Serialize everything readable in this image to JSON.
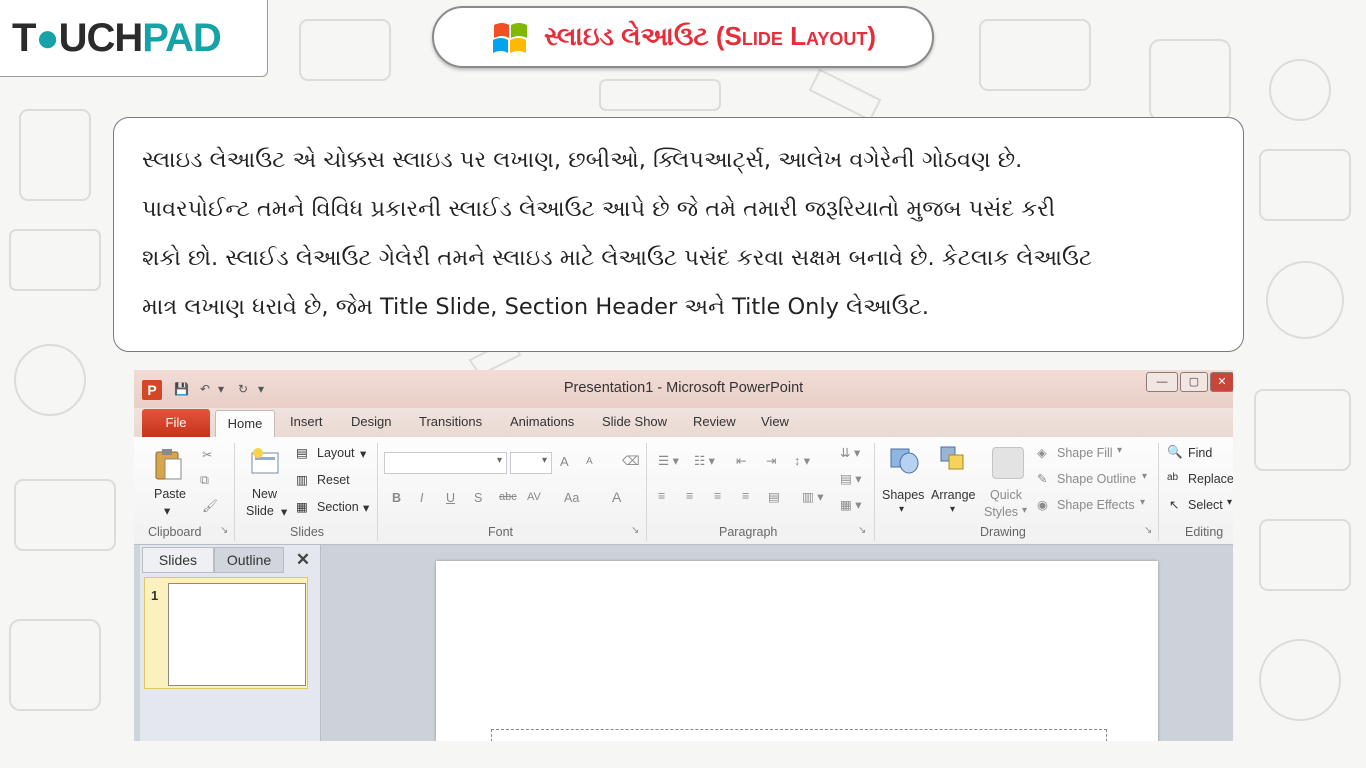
{
  "logo": {
    "part1": "T",
    "part2": "UCH",
    "part3": "PAD",
    "text": "TOUCHPAD"
  },
  "title": {
    "text": "સ્લાઇડ લેઆઉટ (Slide Layout)"
  },
  "paragraph_lines": [
    "સ્લાઇડ લેઆઉટ એ ચોક્કસ સ્લાઇડ પર લખાણ, છબીઓ, ક્લિપઆર્ટ્સ, આલેખ વગેરેની ગોઠવણ છે.",
    "પાવરપોઈન્ટ તમને વિવિધ પ્રકારની સ્લાઈડ લેઆઉટ આપે છે જે તમે તમારી જરૂરિયાતો મુજબ પસંદ કરી",
    "શકો છો. સ્લાઈડ લેઆઉટ ગેલેરી તમને સ્લાઇડ માટે લેઆઉટ પસંદ કરવા સક્ષમ બનાવે છે. કેટલાક લેઆઉટ",
    "માત્ર લખાણ ધરાવે છે, જેમ Title Slide, Section Header  અને Title Only  લેઆઉટ."
  ],
  "ppt": {
    "window_title": "Presentation1  -  Microsoft PowerPoint",
    "tabs": {
      "file": "File",
      "home": "Home",
      "insert": "Insert",
      "design": "Design",
      "transitions": "Transitions",
      "animations": "Animations",
      "slideshow": "Slide Show",
      "review": "Review",
      "view": "View"
    },
    "clipboard": {
      "paste": "Paste",
      "group": "Clipboard"
    },
    "slides": {
      "new_slide_1": "New",
      "new_slide_2": "Slide",
      "layout": "Layout",
      "reset": "Reset",
      "section": "Section",
      "group": "Slides"
    },
    "font": {
      "group": "Font",
      "bold": "B",
      "italic": "I",
      "underline": "U",
      "shadow": "S",
      "strike": "abc",
      "spacing": "AV",
      "case": "Aa",
      "color": "A",
      "grow": "A",
      "shrink": "A"
    },
    "paragraph": {
      "group": "Paragraph"
    },
    "drawing": {
      "shapes": "Shapes",
      "arrange": "Arrange",
      "quick_1": "Quick",
      "quick_2": "Styles",
      "fill": "Shape Fill",
      "outline": "Shape Outline",
      "effects": "Shape Effects",
      "group": "Drawing"
    },
    "editing": {
      "find": "Find",
      "replace": "Replace",
      "select": "Select",
      "group": "Editing"
    },
    "pane": {
      "slides_tab": "Slides",
      "outline_tab": "Outline",
      "close": "✕",
      "slide_number": "1"
    }
  },
  "colors": {
    "title_red": "#e62e3b",
    "logo_teal": "#16a3a8",
    "file_tab": "#d0391f"
  }
}
